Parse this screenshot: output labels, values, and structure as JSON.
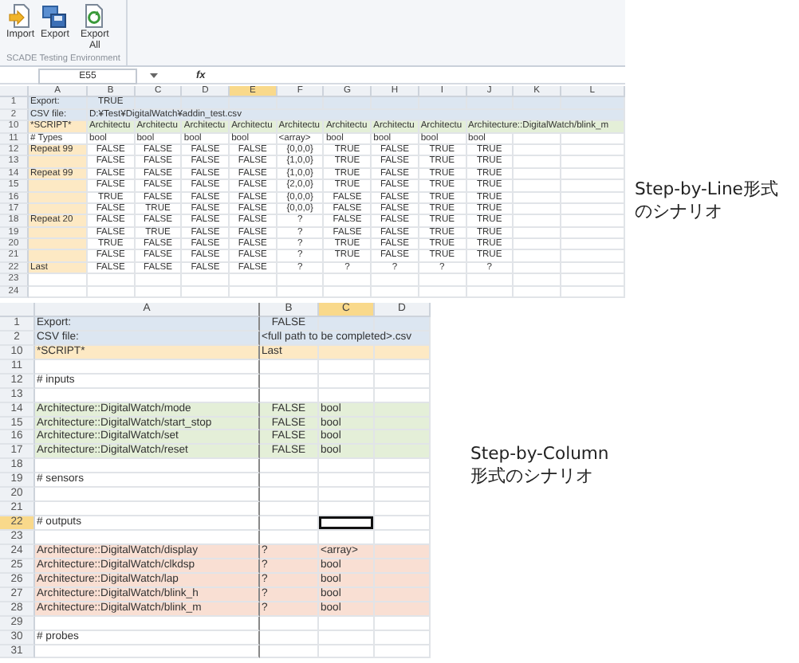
{
  "top_sheet": {
    "ribbon": {
      "buttons": [
        {
          "label": "Import",
          "kind": "import"
        },
        {
          "label": "Export",
          "kind": "export"
        },
        {
          "label": "Export All",
          "kind": "export_all"
        }
      ],
      "group_label": "SCADE Testing Environment"
    },
    "name_box": "E55",
    "formula_label": "fx",
    "columns": [
      {
        "label": "A",
        "selected": false
      },
      {
        "label": "B",
        "selected": false
      },
      {
        "label": "C",
        "selected": false
      },
      {
        "label": "D",
        "selected": false
      },
      {
        "label": "E",
        "selected": true
      },
      {
        "label": "F",
        "selected": false
      },
      {
        "label": "G",
        "selected": false
      },
      {
        "label": "H",
        "selected": false
      },
      {
        "label": "I",
        "selected": false
      },
      {
        "label": "J",
        "selected": false
      },
      {
        "label": "K",
        "selected": false
      },
      {
        "label": "L",
        "selected": false
      }
    ],
    "rows": [
      {
        "number": "1",
        "kind": "setting",
        "label": "Export:",
        "values": [
          "TRUE"
        ],
        "selected": false
      },
      {
        "number": "2",
        "kind": "setting",
        "label": "CSV file:",
        "values": [
          "D:¥Test¥DigitalWatch¥addin_test.csv"
        ],
        "spill": true,
        "selected": false
      },
      {
        "number": "10",
        "kind": "script",
        "label": "*SCRIPT*",
        "values": [
          "Architectu",
          "Architectu",
          "Architectu",
          "Architectu",
          "Architectu",
          "Architectu",
          "Architectu",
          "Architectu",
          "Architecture::DigitalWatch/blink_m"
        ],
        "spill": true,
        "selected": false
      },
      {
        "number": "11",
        "kind": "types",
        "label": "# Types",
        "values": [
          "bool",
          "bool",
          "bool",
          "bool",
          "<array>",
          "bool",
          "bool",
          "bool",
          "bool"
        ],
        "selected": false
      },
      {
        "number": "12",
        "kind": "step",
        "label": "Repeat 99",
        "values": [
          "FALSE",
          "FALSE",
          "FALSE",
          "FALSE",
          "{0,0,0}",
          "TRUE",
          "FALSE",
          "TRUE",
          "TRUE"
        ],
        "selected": false
      },
      {
        "number": "13",
        "kind": "step",
        "values": [
          "FALSE",
          "FALSE",
          "FALSE",
          "FALSE",
          "{1,0,0}",
          "TRUE",
          "FALSE",
          "TRUE",
          "TRUE"
        ],
        "selected": false
      },
      {
        "number": "14",
        "kind": "step",
        "label": "Repeat 99",
        "values": [
          "FALSE",
          "FALSE",
          "FALSE",
          "FALSE",
          "{1,0,0}",
          "TRUE",
          "FALSE",
          "TRUE",
          "TRUE"
        ],
        "selected": false
      },
      {
        "number": "15",
        "kind": "step",
        "values": [
          "FALSE",
          "FALSE",
          "FALSE",
          "FALSE",
          "{2,0,0}",
          "TRUE",
          "FALSE",
          "TRUE",
          "TRUE"
        ],
        "selected": false
      },
      {
        "number": "16",
        "kind": "step",
        "values": [
          "TRUE",
          "FALSE",
          "FALSE",
          "FALSE",
          "{0,0,0}",
          "FALSE",
          "FALSE",
          "TRUE",
          "TRUE"
        ],
        "selected": false
      },
      {
        "number": "17",
        "kind": "step",
        "values": [
          "FALSE",
          "TRUE",
          "FALSE",
          "FALSE",
          "{0,0,0}",
          "FALSE",
          "FALSE",
          "TRUE",
          "TRUE"
        ],
        "selected": false
      },
      {
        "number": "18",
        "kind": "step",
        "label": "Repeat 20",
        "values": [
          "FALSE",
          "FALSE",
          "FALSE",
          "FALSE",
          "?",
          "FALSE",
          "FALSE",
          "TRUE",
          "TRUE"
        ],
        "selected": false
      },
      {
        "number": "19",
        "kind": "step",
        "values": [
          "FALSE",
          "TRUE",
          "FALSE",
          "FALSE",
          "?",
          "FALSE",
          "FALSE",
          "TRUE",
          "TRUE"
        ],
        "selected": false
      },
      {
        "number": "20",
        "kind": "step",
        "values": [
          "TRUE",
          "FALSE",
          "FALSE",
          "FALSE",
          "?",
          "TRUE",
          "FALSE",
          "TRUE",
          "TRUE"
        ],
        "selected": false
      },
      {
        "number": "21",
        "kind": "step",
        "values": [
          "FALSE",
          "FALSE",
          "FALSE",
          "FALSE",
          "?",
          "TRUE",
          "FALSE",
          "TRUE",
          "TRUE"
        ],
        "selected": false
      },
      {
        "number": "22",
        "kind": "step",
        "label": "Last",
        "values": [
          "FALSE",
          "FALSE",
          "FALSE",
          "FALSE",
          "?",
          "?",
          "?",
          "?",
          "?"
        ],
        "selected": false
      },
      {
        "number": "23",
        "kind": "plain",
        "selected": false
      },
      {
        "number": "24",
        "kind": "plain",
        "selected": false
      }
    ],
    "caption": {
      "lines": [
        "Step-by-Line形式",
        "のシナリオ"
      ]
    }
  },
  "bottom_sheet": {
    "columns": [
      {
        "label": "A",
        "selected": false
      },
      {
        "label": "B",
        "selected": false
      },
      {
        "label": "C",
        "selected": true
      },
      {
        "label": "D",
        "selected": false
      }
    ],
    "rows": [
      {
        "number": "1",
        "kind": "setting",
        "label": "Export:",
        "values": [
          "FALSE"
        ],
        "selected": false
      },
      {
        "number": "2",
        "kind": "setting",
        "label": "CSV file:",
        "values": [
          "<full path to be completed>.csv"
        ],
        "spill": true,
        "selected": false
      },
      {
        "number": "10",
        "kind": "script",
        "label": "*SCRIPT*",
        "values": [
          "Last"
        ],
        "selected": false
      },
      {
        "number": "11",
        "kind": "plain",
        "selected": false
      },
      {
        "number": "12",
        "kind": "plain",
        "label": "# inputs",
        "selected": false
      },
      {
        "number": "13",
        "kind": "plain",
        "selected": false
      },
      {
        "number": "14",
        "kind": "input",
        "label": "Architecture::DigitalWatch/mode",
        "values": [
          "FALSE",
          "bool"
        ],
        "selected": false
      },
      {
        "number": "15",
        "kind": "input",
        "label": "Architecture::DigitalWatch/start_stop",
        "values": [
          "FALSE",
          "bool"
        ],
        "selected": false
      },
      {
        "number": "16",
        "kind": "input",
        "label": "Architecture::DigitalWatch/set",
        "values": [
          "FALSE",
          "bool"
        ],
        "selected": false
      },
      {
        "number": "17",
        "kind": "input",
        "label": "Architecture::DigitalWatch/reset",
        "values": [
          "FALSE",
          "bool"
        ],
        "selected": false
      },
      {
        "number": "18",
        "kind": "plain",
        "selected": false
      },
      {
        "number": "19",
        "kind": "plain",
        "label": "# sensors",
        "selected": false
      },
      {
        "number": "20",
        "kind": "plain",
        "selected": false
      },
      {
        "number": "21",
        "kind": "plain",
        "selected": false
      },
      {
        "number": "22",
        "kind": "plain",
        "label": "# outputs",
        "selected": true
      },
      {
        "number": "23",
        "kind": "plain",
        "selected": false
      },
      {
        "number": "24",
        "kind": "output",
        "label": "Architecture::DigitalWatch/display",
        "values": [
          "?",
          "<array>"
        ],
        "selected": false
      },
      {
        "number": "25",
        "kind": "output",
        "label": "Architecture::DigitalWatch/clkdsp",
        "values": [
          "?",
          "bool"
        ],
        "selected": false
      },
      {
        "number": "26",
        "kind": "output",
        "label": "Architecture::DigitalWatch/lap",
        "values": [
          "?",
          "bool"
        ],
        "selected": false
      },
      {
        "number": "27",
        "kind": "output",
        "label": "Architecture::DigitalWatch/blink_h",
        "values": [
          "?",
          "bool"
        ],
        "selected": false
      },
      {
        "number": "28",
        "kind": "output",
        "label": "Architecture::DigitalWatch/blink_m",
        "values": [
          "?",
          "bool"
        ],
        "selected": false
      },
      {
        "number": "29",
        "kind": "plain",
        "selected": false
      },
      {
        "number": "30",
        "kind": "plain",
        "label": "# probes",
        "selected": false
      },
      {
        "number": "31",
        "kind": "plain",
        "selected": false
      }
    ],
    "caption": {
      "lines": [
        "Step-by-Column",
        "形式のシナリオ"
      ]
    }
  }
}
